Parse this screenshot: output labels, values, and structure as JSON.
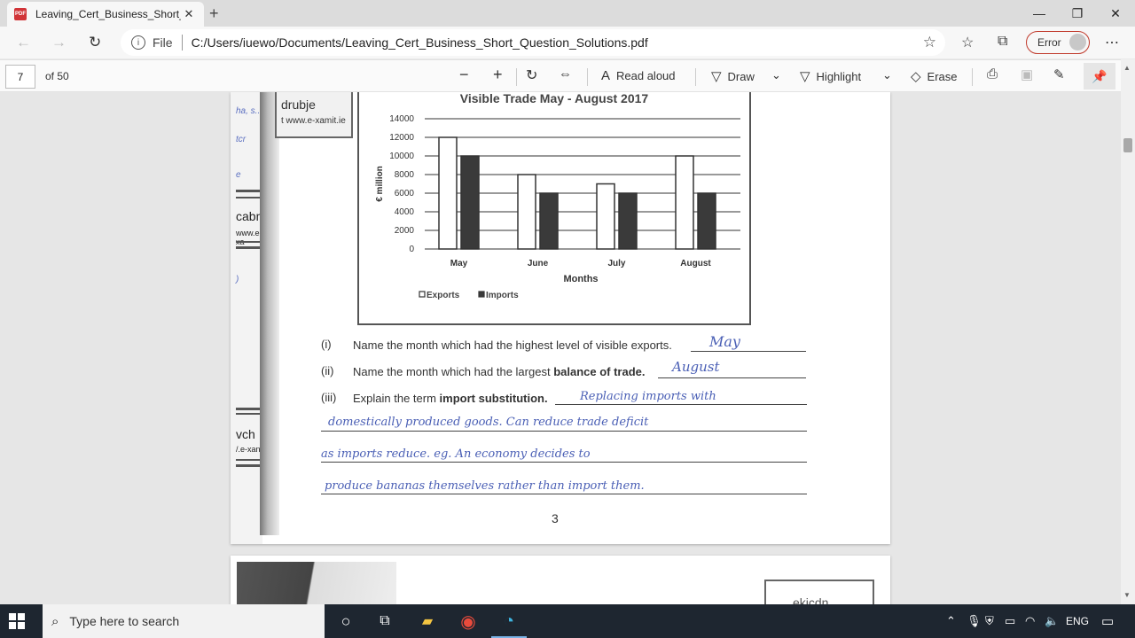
{
  "browser": {
    "tab_title": "Leaving_Cert_Business_Short_Qu",
    "tab_close": "✕",
    "new_tab": "+",
    "window_controls": {
      "minimize": "—",
      "restore": "❐",
      "close": "✕"
    }
  },
  "address_bar": {
    "file_label": "File",
    "url": "C:/Users/iuewo/Documents/Leaving_Cert_Business_Short_Question_Solutions.pdf",
    "profile_status": "Error"
  },
  "pdf_toolbar": {
    "page_current": "7",
    "page_total": "of 50",
    "read_aloud": "Read aloud",
    "draw": "Draw",
    "highlight": "Highlight",
    "erase": "Erase"
  },
  "document": {
    "left_strip": {
      "brand_top": "drubje",
      "brand_site": "t www.e-xamit.ie",
      "frag1": "cabm",
      "frag2": "www.e-xa",
      "frag3": "vch",
      "frag4": "/.e-xan"
    },
    "questions": [
      {
        "num": "(i)",
        "pre": "Name the month which had the highest level of visible exports.",
        "bold": "",
        "answer": "May"
      },
      {
        "num": "(ii)",
        "pre": "Name the month which had the largest ",
        "bold": "balance of trade.",
        "answer": "August"
      },
      {
        "num": "(iii)",
        "pre": "Explain the term ",
        "bold": "import substitution.",
        "answer": "Replacing imports with"
      }
    ],
    "answer_lines": [
      "domestically produced goods. Can reduce trade deficit",
      "as imports reduce.   eg. An economy decides to",
      "produce bananas themselves rather than import them."
    ],
    "page_number": "3",
    "next_page_box": "ekicdn"
  },
  "chart_data": {
    "type": "bar",
    "title": "Visible Trade May - August 2017",
    "xlabel": "Months",
    "ylabel": "€ million",
    "categories": [
      "May",
      "June",
      "July",
      "August"
    ],
    "series": [
      {
        "name": "Exports",
        "values": [
          12000,
          8000,
          7000,
          10000
        ],
        "color": "#ffffff"
      },
      {
        "name": "Imports",
        "values": [
          10000,
          6000,
          6000,
          6000
        ],
        "color": "#3a3a3a"
      }
    ],
    "ylim": [
      0,
      14000
    ],
    "yticks": [
      0,
      2000,
      4000,
      6000,
      8000,
      10000,
      12000,
      14000
    ],
    "grid": true,
    "legend_position": "bottom-left"
  },
  "taskbar": {
    "search_placeholder": "Type here to search",
    "language": "ENG"
  }
}
